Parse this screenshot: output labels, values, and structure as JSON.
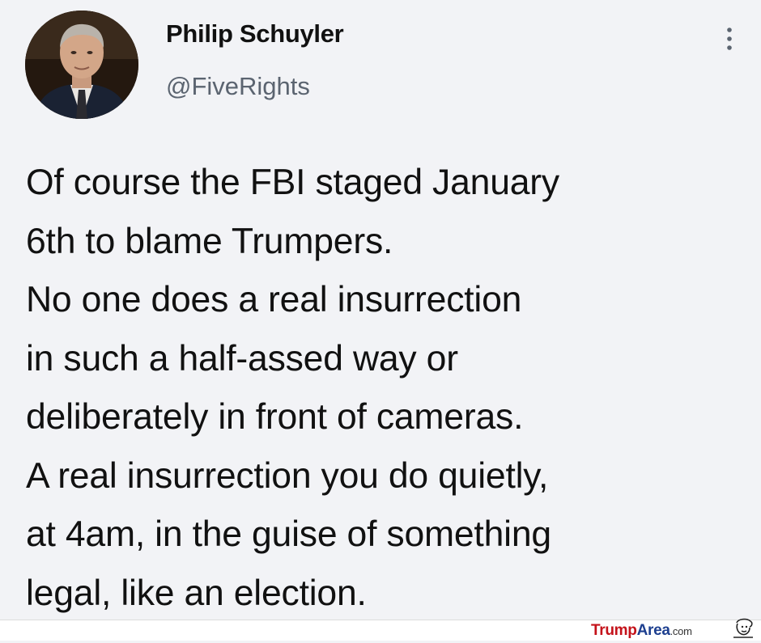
{
  "tweet": {
    "author": {
      "display_name": "Philip Schuyler",
      "handle": "@FiveRights"
    },
    "menu_icon": "more-vertical-icon",
    "text_lines": [
      "Of course the FBI staged January",
      "6th to blame Trumpers.",
      "No one does a real insurrection",
      "in such a half-assed way or",
      "deliberately in front of cameras.",
      "A real insurrection you do quietly,",
      "at 4am, in the guise of something",
      "legal, like an election."
    ]
  },
  "watermark": {
    "part1": "Trump",
    "part2": "Area",
    "part3": ".com",
    "colors": {
      "part1": "#c4121a",
      "part2": "#1d3f8f"
    }
  }
}
